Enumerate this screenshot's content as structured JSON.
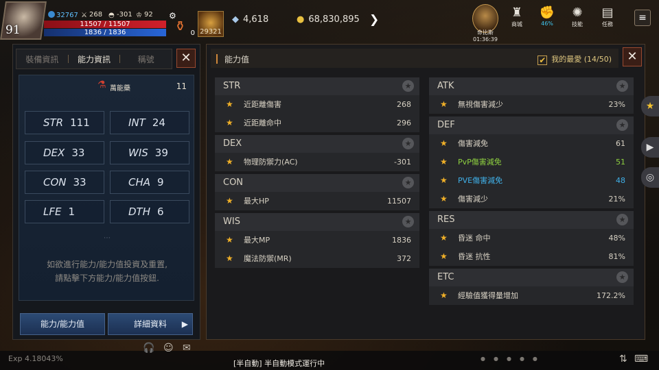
{
  "hud": {
    "level": "91",
    "power": "32767",
    "stat_a": "268",
    "stat_b": "-301",
    "stat_c": "92",
    "hp": "11507 / 11507",
    "mp": "1836 / 1836",
    "potion_count": "0",
    "item_count": "29321",
    "crystals": "4,618",
    "gold": "68,830,895",
    "boss_label": "命比斯",
    "boss_timer": "01:36:39",
    "shop_label": "商城",
    "progress_label": "46%",
    "skill_label": "技能",
    "quest_label": "任務"
  },
  "left_panel": {
    "tabs": [
      "裝備資訊",
      "能力資訊",
      "稱號"
    ],
    "bonus_label": "萬能藥",
    "bonus_value": "11",
    "attributes": [
      {
        "name": "STR",
        "value": "111"
      },
      {
        "name": "INT",
        "value": "24"
      },
      {
        "name": "DEX",
        "value": "33"
      },
      {
        "name": "WIS",
        "value": "39"
      },
      {
        "name": "CON",
        "value": "33"
      },
      {
        "name": "CHA",
        "value": "9"
      },
      {
        "name": "LFE",
        "value": "1"
      },
      {
        "name": "DTH",
        "value": "6"
      }
    ],
    "hint_line1": "如欲進行能力/能力值投資及重置,",
    "hint_line2": "請點擊下方能力/能力值按鈕.",
    "btn_attr": "能力/能力值",
    "btn_detail": "詳細資料"
  },
  "right_panel": {
    "title": "能力值",
    "favorites": "我的最愛 (14/50)",
    "left_groups": [
      {
        "name": "STR",
        "rows": [
          {
            "label": "近距離傷害",
            "value": "268"
          },
          {
            "label": "近距離命中",
            "value": "296"
          }
        ]
      },
      {
        "name": "DEX",
        "rows": [
          {
            "label": "物理防禦力(AC)",
            "value": "-301"
          }
        ]
      },
      {
        "name": "CON",
        "rows": [
          {
            "label": "最大HP",
            "value": "11507"
          }
        ]
      },
      {
        "name": "WIS",
        "rows": [
          {
            "label": "最大MP",
            "value": "1836"
          },
          {
            "label": "魔法防禦(MR)",
            "value": "372"
          }
        ]
      }
    ],
    "right_groups": [
      {
        "name": "ATK",
        "rows": [
          {
            "label": "無視傷害減少",
            "value": "23%"
          }
        ]
      },
      {
        "name": "DEF",
        "rows": [
          {
            "label": "傷害減免",
            "value": "61"
          },
          {
            "label": "PvP傷害減免",
            "value": "51",
            "color": "green"
          },
          {
            "label": "PVE傷害減免",
            "value": "48",
            "color": "cyan"
          },
          {
            "label": "傷害減少",
            "value": "21%"
          }
        ]
      },
      {
        "name": "RES",
        "rows": [
          {
            "label": "昏迷 命中",
            "value": "48%"
          },
          {
            "label": "昏迷 抗性",
            "value": "81%"
          }
        ]
      },
      {
        "name": "ETC",
        "rows": [
          {
            "label": "經驗值獲得量增加",
            "value": "172.2%"
          }
        ]
      }
    ]
  },
  "bottom": {
    "exp": "Exp  4.18043%",
    "auto_mode": "[半自動] 半自動模式運行中"
  }
}
